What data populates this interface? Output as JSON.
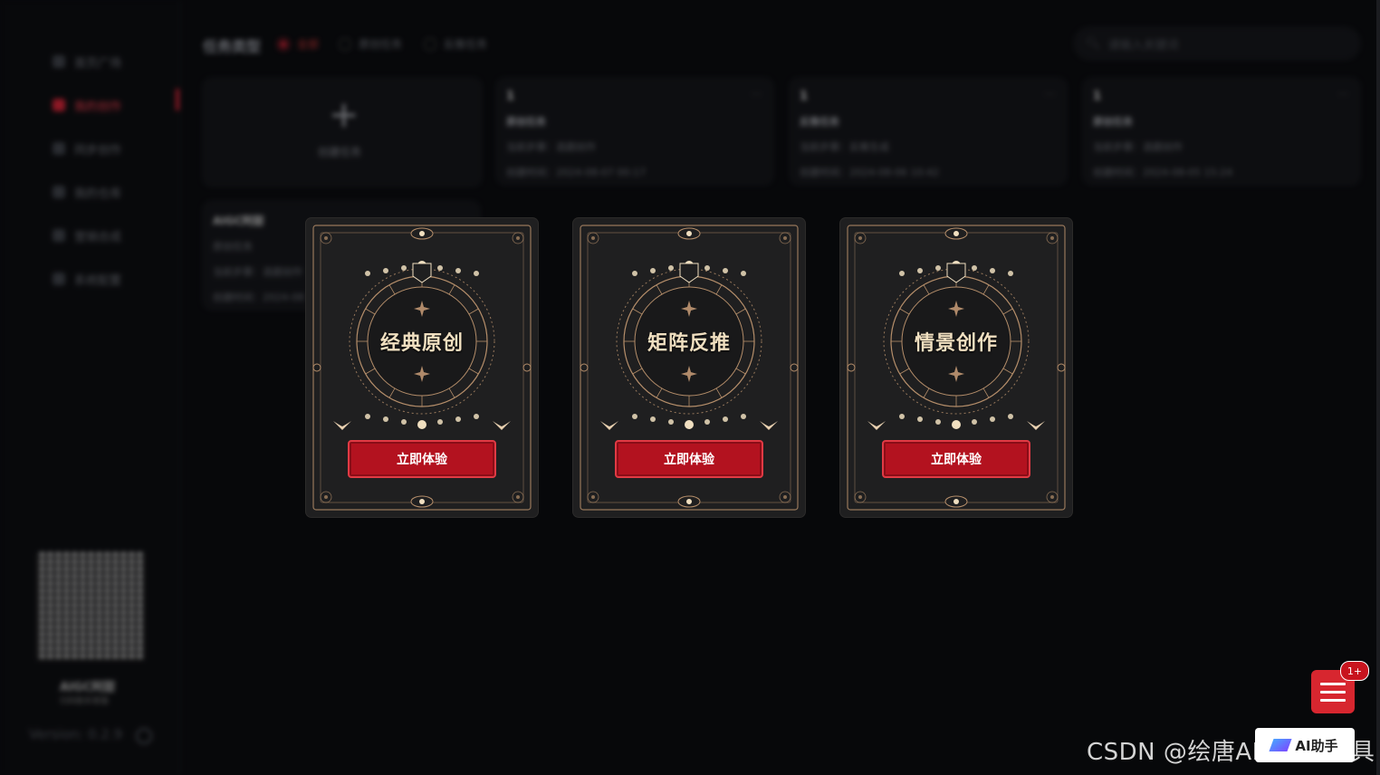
{
  "sidebar": {
    "items": [
      {
        "label": "首页广场",
        "active": false
      },
      {
        "label": "我的创作",
        "active": true
      },
      {
        "label": "同步创作",
        "active": false
      },
      {
        "label": "我的仓库",
        "active": false
      },
      {
        "label": "营销合成",
        "active": false
      },
      {
        "label": "系统配置",
        "active": false
      }
    ],
    "qr_label": "AIGC阿甜",
    "qr_sub": "扫码联系客服",
    "version": "Version: 0.2.9"
  },
  "toolbar": {
    "title": "任务类型",
    "filters": [
      {
        "label": "全部",
        "selected": true
      },
      {
        "label": "原创任务",
        "selected": false
      },
      {
        "label": "反推任务",
        "selected": false
      }
    ],
    "search_placeholder": "请输入关键词"
  },
  "create_card": {
    "label": "创建任务"
  },
  "task_cards": [
    {
      "num": "1",
      "type": "原创任务",
      "status": "当前步骤：选题创作",
      "time": "创建时间：2024-08-07 00:17"
    },
    {
      "num": "1",
      "type": "反推任务",
      "status": "当前步骤：反推生成",
      "time": "创建时间：2024-08-06 10:42"
    },
    {
      "num": "1",
      "type": "原创任务",
      "status": "当前步骤：选题创作",
      "time": "创建时间：2024-08-05 15:24"
    }
  ],
  "second_row_card": {
    "title": "AIGC阿甜",
    "type": "原创任务",
    "status": "当前步骤：选题创作",
    "time": "创建时间：2024-08"
  },
  "modal": {
    "cards": [
      {
        "title": "经典原创",
        "button": "立即体验"
      },
      {
        "title": "矩阵反推",
        "button": "立即体验"
      },
      {
        "title": "情景创作",
        "button": "立即体验"
      }
    ]
  },
  "floating": {
    "badge": "1+",
    "ai_helper": "AI助手",
    "watermark": "CSDN @绘唐AIGC AI工具"
  },
  "colors": {
    "accent": "#c22233",
    "button": "#b3121f",
    "card_bg": "#1f1f20",
    "ornament": "#b58e6a",
    "title_text": "#f0dfc0"
  }
}
